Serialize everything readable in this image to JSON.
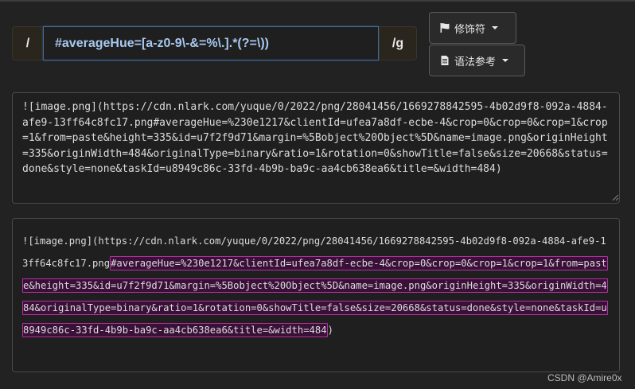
{
  "regex": {
    "prefix": "/",
    "pattern": "#averageHue=[a-z0-9\\-&=%\\.].*(?=\\))",
    "suffix": "/g"
  },
  "buttons": {
    "flags_label": "修饰符",
    "reference_label": "语法参考"
  },
  "source_text": "![image.png](https://cdn.nlark.com/yuque/0/2022/png/28041456/1669278842595-4b02d9f8-092a-4884-afe9-13ff64c8fc17.png#averageHue=%230e1217&clientId=ufea7a8df-ecbe-4&crop=0&crop=0&crop=1&crop=1&from=paste&height=335&id=u7f2f9d71&margin=%5Bobject%20Object%5D&name=image.png&originHeight=335&originWidth=484&originalType=binary&ratio=1&rotation=0&showTitle=false&size=20668&status=done&style=none&taskId=u8949c86c-33fd-4b9b-ba9c-aa4cb638ea6&title=&width=484)",
  "result": {
    "before": "![image.png](https://cdn.nlark.com/yuque/0/2022/png/28041456/1669278842595-4b02d9f8-092a-4884-afe9-13ff64c8fc17.png",
    "match": "#averageHue=%230e1217&clientId=ufea7a8df-ecbe-4&crop=0&crop=0&crop=1&crop=1&from=paste&height=335&id=u7f2f9d71&margin=%5Bobject%20Object%5D&name=image.png&originHeight=335&originWidth=484&originalType=binary&ratio=1&rotation=0&showTitle=false&size=20668&status=done&style=none&taskId=u8949c86c-33fd-4b9b-ba9c-aa4cb638ea6&title=&width=484",
    "after": ")"
  },
  "watermark": "CSDN @Amire0x",
  "icons": {
    "flags": "flag-icon",
    "reference": "document-icon"
  },
  "colors": {
    "background": "#222222",
    "match_bg": "#3a1038",
    "match_border": "#b0349e",
    "regex_text": "#a8c8f0"
  }
}
